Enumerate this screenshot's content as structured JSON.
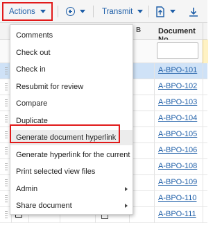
{
  "toolbar": {
    "actions_label": "Actions",
    "transmit_label": "Transmit"
  },
  "grid": {
    "column_header": "Document No.",
    "rows": [
      {
        "doc_no": "A-BPO-101",
        "selected": true
      },
      {
        "doc_no": "A-BPO-102"
      },
      {
        "doc_no": "A-BPO-103"
      },
      {
        "doc_no": "A-BPO-104"
      },
      {
        "doc_no": "A-BPO-105"
      },
      {
        "doc_no": "A-BPO-106"
      },
      {
        "doc_no": "A-BPO-108"
      },
      {
        "doc_no": "A-BPO-109"
      },
      {
        "doc_no": "A-BPO-110"
      },
      {
        "doc_no": "A-BPO-111"
      }
    ]
  },
  "menu": {
    "items": [
      {
        "label": "Comments"
      },
      {
        "label": "Check out"
      },
      {
        "label": "Check in"
      },
      {
        "label": "Resubmit for review"
      },
      {
        "label": "Compare"
      },
      {
        "label": "Duplicate"
      },
      {
        "label": "Generate document hyperlink",
        "highlighted": true
      },
      {
        "label": "Generate hyperlink for the current r..."
      },
      {
        "label": "Print selected view files"
      },
      {
        "label": "Admin",
        "submenu": true
      },
      {
        "label": "Share document",
        "submenu": true
      }
    ]
  },
  "colors": {
    "accent": "#1f5fa8",
    "callout": "#e11a1a",
    "selected_row": "#cfe2f7"
  }
}
